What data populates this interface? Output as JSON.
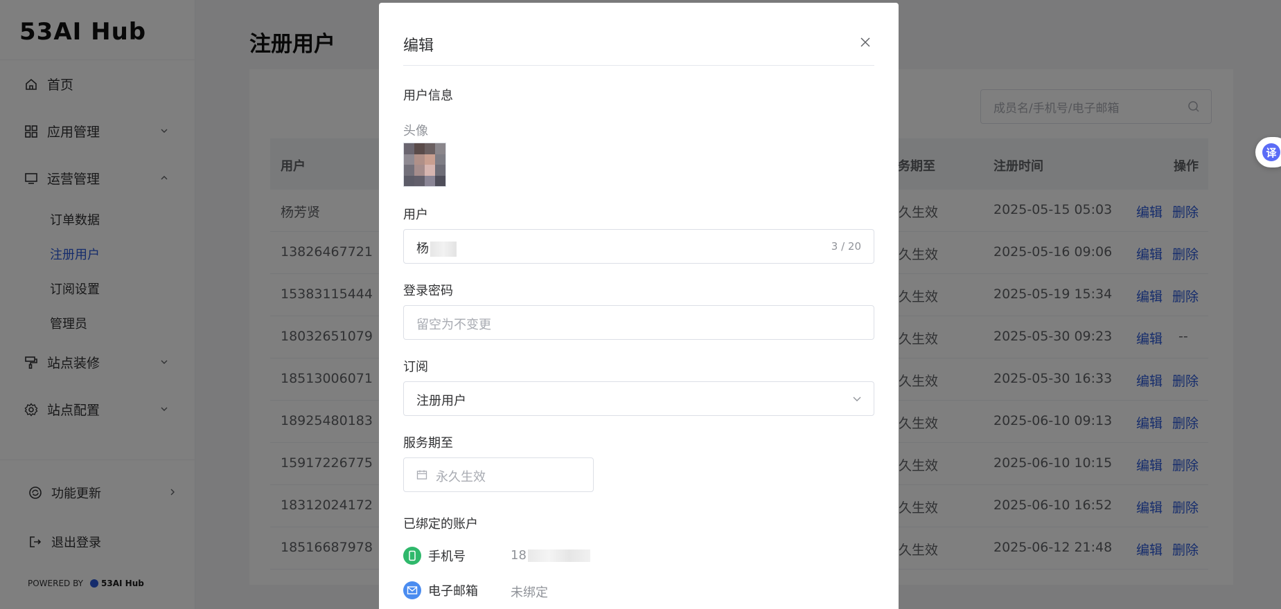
{
  "sidebar": {
    "logo": "53AI Hub",
    "items": [
      {
        "label": "首页"
      },
      {
        "label": "应用管理"
      },
      {
        "label": "运营管理"
      },
      {
        "label": "站点装修"
      },
      {
        "label": "站点配置"
      }
    ],
    "sub_items": [
      {
        "label": "订单数据"
      },
      {
        "label": "注册用户"
      },
      {
        "label": "订阅设置"
      },
      {
        "label": "管理员"
      }
    ],
    "footer": {
      "updates": "功能更新",
      "logout": "退出登录",
      "powered_by": "POWERED BY",
      "brand": "53AI Hub"
    }
  },
  "main": {
    "title": "注册用户",
    "search_placeholder": "成员名/手机号/电子邮箱",
    "columns": {
      "user": "用户",
      "service_until": "服务期至",
      "registered_at": "注册时间",
      "actions": "操作"
    },
    "rows": [
      {
        "user": "杨芳贤",
        "service": "永久生效",
        "time": "2025-05-15 05:03",
        "edit": "编辑",
        "delete": "删除"
      },
      {
        "user": "13826467721",
        "service": "永久生效",
        "time": "2025-05-16 09:06",
        "edit": "编辑",
        "delete": "删除"
      },
      {
        "user": "15383115444",
        "service": "永久生效",
        "time": "2025-05-19 15:34",
        "edit": "编辑",
        "delete": "删除"
      },
      {
        "user": "18032651079",
        "service": "永久生效",
        "time": "2025-05-30 09:23",
        "edit": "编辑",
        "delete": "--"
      },
      {
        "user": "18513006071",
        "service": "永久生效",
        "time": "2025-05-30 16:33",
        "edit": "编辑",
        "delete": "删除"
      },
      {
        "user": "18925480183",
        "service": "永久生效",
        "time": "2025-06-10 09:13",
        "edit": "编辑",
        "delete": "删除"
      },
      {
        "user": "15917226775",
        "service": "永久生效",
        "time": "2025-06-10 10:15",
        "edit": "编辑",
        "delete": "删除"
      },
      {
        "user": "18312024172",
        "service": "永久生效",
        "time": "2025-06-10 16:52",
        "edit": "编辑",
        "delete": "删除"
      },
      {
        "user": "18516687978",
        "service": "永久生效",
        "time": "2025-06-12 21:48",
        "edit": "编辑",
        "delete": "删除"
      }
    ]
  },
  "translate_label": "译",
  "modal": {
    "title": "编辑",
    "section_user_info": "用户信息",
    "avatar_label": "头像",
    "user_label": "用户",
    "user_value": "杨",
    "user_counter": "3 / 20",
    "password_label": "登录密码",
    "password_placeholder": "留空为不变更",
    "subscription_label": "订阅",
    "subscription_value": "注册用户",
    "service_label": "服务期至",
    "service_placeholder": "永久生效",
    "bound_label": "已绑定的账户",
    "phone_label": "手机号",
    "phone_value": "18",
    "email_label": "电子邮箱",
    "email_value": "未绑定"
  },
  "colors": {
    "accent": "#2b59d8",
    "phone_icon": "#2fb86b",
    "email_icon": "#4a8cf0"
  }
}
